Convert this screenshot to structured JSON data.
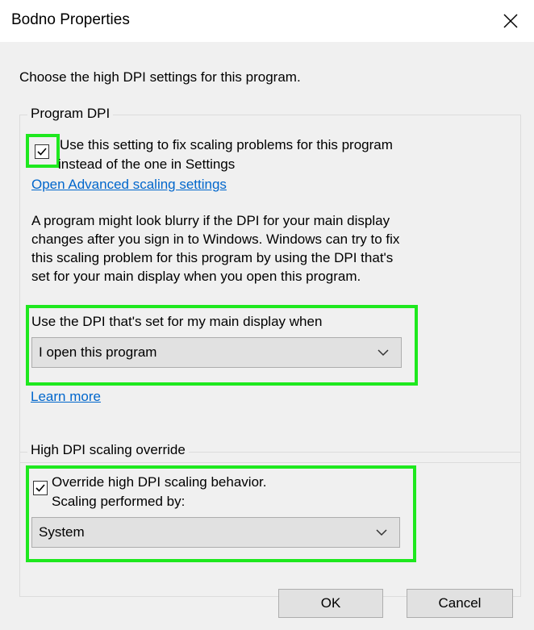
{
  "window": {
    "title": "Bodno Properties"
  },
  "intro": "Choose the high DPI settings for this program.",
  "program_dpi": {
    "legend": "Program DPI",
    "checkbox_label_line1": "Use this setting to fix scaling problems for this program",
    "checkbox_label_line2": "instead of the one in Settings",
    "checkbox_checked": true,
    "advanced_link": "Open Advanced scaling settings",
    "desc_line1": "A program might look blurry if the DPI for your main display",
    "desc_line2": "changes after you sign in to Windows. Windows can try to fix",
    "desc_line3": "this scaling problem for this program by using the DPI that's",
    "desc_line4": "set for your main display when you open this program.",
    "select_label": "Use the DPI that's set for my main display when",
    "select_value": "I open this program",
    "learn_more": "Learn more"
  },
  "override": {
    "legend": "High DPI scaling override",
    "checkbox_label_line1": "Override high DPI scaling behavior.",
    "checkbox_label_line2": "Scaling performed by:",
    "checkbox_checked": true,
    "select_value": "System"
  },
  "buttons": {
    "ok": "OK",
    "cancel": "Cancel"
  },
  "colors": {
    "highlight": "#1ee81e",
    "link": "#0066cc",
    "background": "#f0f0f0"
  }
}
